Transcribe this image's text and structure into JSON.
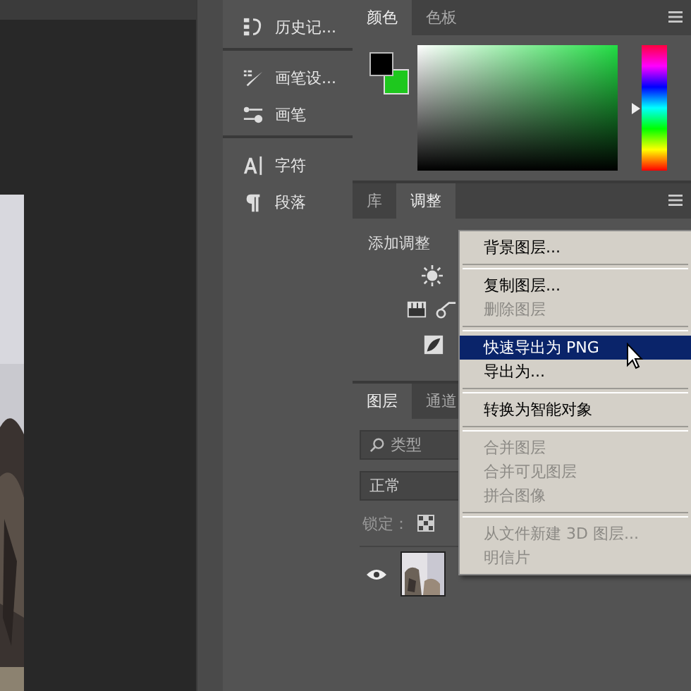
{
  "panel_dock": {
    "groups": [
      {
        "items": [
          {
            "kind": "history",
            "label": "历史记..."
          }
        ]
      },
      {
        "items": [
          {
            "kind": "brush-settings",
            "label": "画笔设..."
          },
          {
            "kind": "brush",
            "label": "画笔"
          }
        ]
      },
      {
        "items": [
          {
            "kind": "character",
            "label": "字符"
          },
          {
            "kind": "paragraph",
            "label": "段落"
          }
        ]
      }
    ]
  },
  "color_panel": {
    "tabs": [
      {
        "label": "颜色",
        "selected": true
      },
      {
        "label": "色板",
        "selected": false
      }
    ],
    "hue": {
      "level": 0.5
    }
  },
  "adjustments_panel": {
    "tabs": [
      {
        "label": "库",
        "selected": false
      },
      {
        "label": "调整",
        "selected": true
      }
    ],
    "heading": "添加调整"
  },
  "layers_panel": {
    "tabs": [
      {
        "label": "图层",
        "selected": true
      },
      {
        "label": "通道",
        "selected": false
      }
    ],
    "search": {
      "placeholder": "类型"
    },
    "blend_mode": "正常",
    "lock_label": "锁定：",
    "layers": [
      {
        "visible": true
      }
    ]
  },
  "context_menu": {
    "groups": [
      [
        {
          "label": "背景图层...",
          "disabled": false,
          "selected": false
        }
      ],
      [
        {
          "label": "复制图层...",
          "disabled": false,
          "selected": false
        },
        {
          "label": "删除图层",
          "disabled": true,
          "selected": false
        }
      ],
      [
        {
          "label": "快速导出为 PNG",
          "disabled": false,
          "selected": true
        },
        {
          "label": "导出为...",
          "disabled": false,
          "selected": false
        }
      ],
      [
        {
          "label": "转换为智能对象",
          "disabled": false,
          "selected": false
        }
      ],
      [
        {
          "label": "合并图层",
          "disabled": true,
          "selected": false
        },
        {
          "label": "合并可见图层",
          "disabled": true,
          "selected": false
        },
        {
          "label": "拼合图像",
          "disabled": true,
          "selected": false
        }
      ],
      [
        {
          "label": "从文件新建 3D 图层...",
          "disabled": true,
          "selected": false
        },
        {
          "label": "明信片",
          "disabled": true,
          "selected": false
        }
      ]
    ]
  }
}
